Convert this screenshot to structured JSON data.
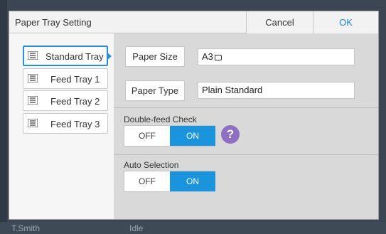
{
  "background": {
    "user": "T.Smith",
    "status": "Idle",
    "icons": [
      "key-icon",
      "k-icon",
      "c-icon",
      "m-icon",
      "y-icon",
      "settings-icon"
    ]
  },
  "dialog": {
    "title": "Paper Tray Setting",
    "cancel_label": "Cancel",
    "ok_label": "OK"
  },
  "trays": [
    {
      "label": "Standard Tray",
      "selected": true
    },
    {
      "label": "Feed Tray 1",
      "selected": false
    },
    {
      "label": "Feed Tray 2",
      "selected": false
    },
    {
      "label": "Feed Tray 3",
      "selected": false
    }
  ],
  "settings": {
    "paper_size": {
      "label": "Paper Size",
      "value": "A3"
    },
    "paper_type": {
      "label": "Paper Type",
      "value": "Plain Standard"
    },
    "double_feed": {
      "label": "Double-feed Check",
      "off": "OFF",
      "on": "ON",
      "state": "ON"
    },
    "auto_selection": {
      "label": "Auto Selection",
      "off": "OFF",
      "on": "ON",
      "state": "ON"
    },
    "help_glyph": "?"
  },
  "colors": {
    "accent": "#1a94dd",
    "help": "#8e6fc2",
    "ok_text": "#1f7fd1"
  }
}
